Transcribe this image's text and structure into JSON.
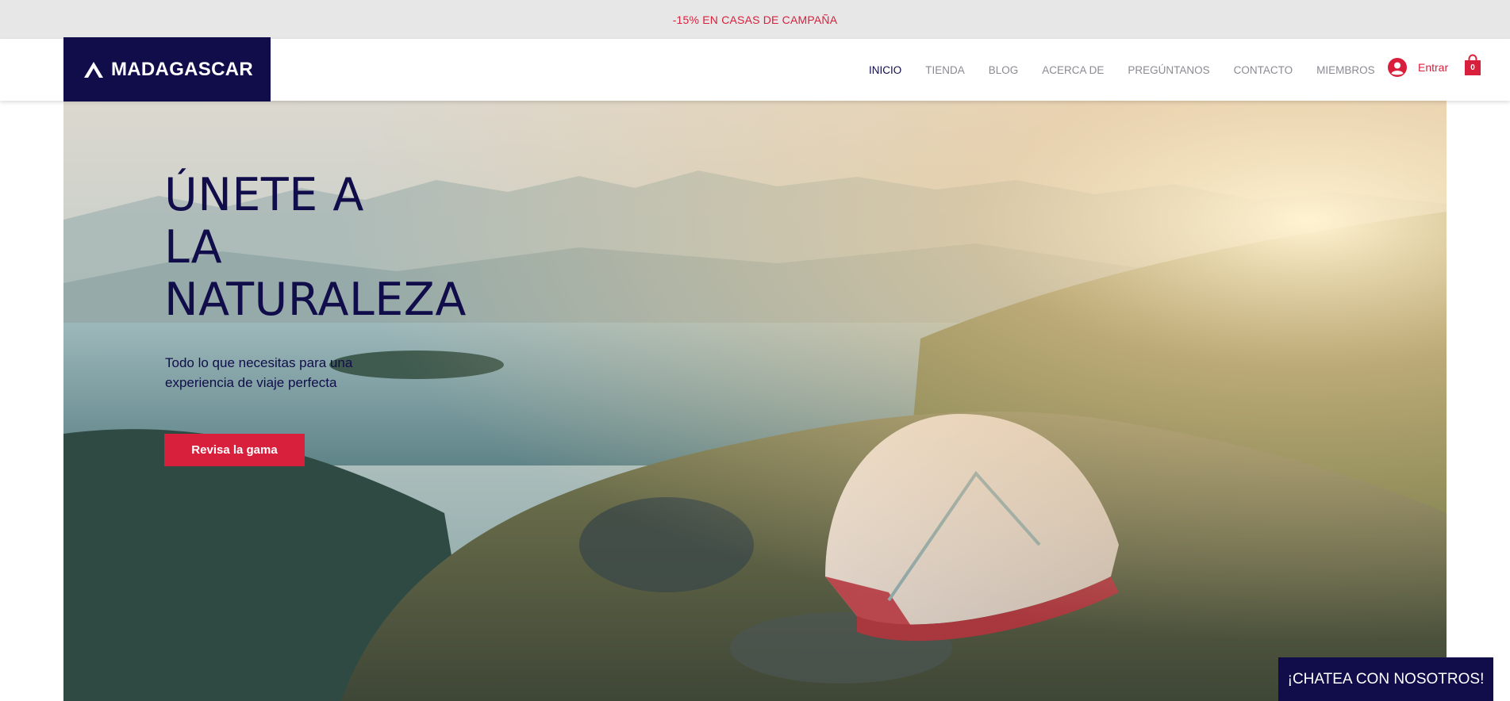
{
  "promo": {
    "text": "-15% EN CASAS DE CAMPAÑA"
  },
  "brand": {
    "name": "MADAGASCAR",
    "icon": "mountain-icon",
    "color": "#100d4a"
  },
  "nav": {
    "items": [
      {
        "label": "INICIO",
        "active": true
      },
      {
        "label": "TIENDA"
      },
      {
        "label": "BLOG"
      },
      {
        "label": "ACERCA DE"
      },
      {
        "label": "PREGÚNTANOS"
      },
      {
        "label": "CONTACTO"
      },
      {
        "label": "MIEMBROS"
      }
    ]
  },
  "login": {
    "label": "Entrar",
    "icon": "user-icon"
  },
  "cart": {
    "count": "0",
    "icon": "shopping-bag-icon"
  },
  "hero": {
    "title_lines": [
      "ÚNETE A",
      "LA",
      "NATURALEZA"
    ],
    "subtitle": "Todo lo que necesitas para una experiencia de viaje perfecta",
    "cta_label": "Revisa la gama"
  },
  "chat": {
    "label": "¡CHATEA CON NOSOTROS!"
  },
  "colors": {
    "accent": "#d8203c",
    "brand": "#100d4a",
    "promo_bg": "#e8e7e8"
  }
}
